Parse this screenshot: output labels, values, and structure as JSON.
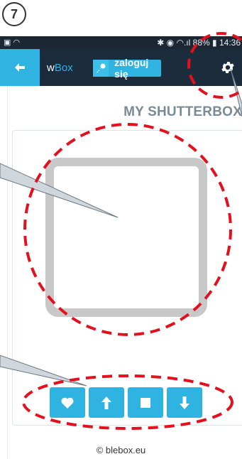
{
  "step_number": "7",
  "status_bar": {
    "left_icons": "▣ ◠",
    "right_icons": "✱ ◉ ◠.ıl",
    "battery": "88%",
    "time": "14:36"
  },
  "app_bar": {
    "app_name_prefix": "w",
    "app_name_accent": "Box",
    "login_label": "zaloguj się",
    "back_icon": "arrow-left-icon",
    "login_icon": "key-icon",
    "settings_icon": "gear-icon"
  },
  "device": {
    "title": "MY SHUTTERBOX"
  },
  "controls": [
    {
      "name": "favorite",
      "icon": "heart-icon"
    },
    {
      "name": "up",
      "icon": "arrow-up-icon"
    },
    {
      "name": "stop",
      "icon": "stop-icon"
    },
    {
      "name": "down",
      "icon": "arrow-down-icon"
    }
  ],
  "footer": "© blebox.eu",
  "colors": {
    "accent": "#2fb3e0",
    "header": "#1b2d3c",
    "annotation": "#e3101e"
  }
}
